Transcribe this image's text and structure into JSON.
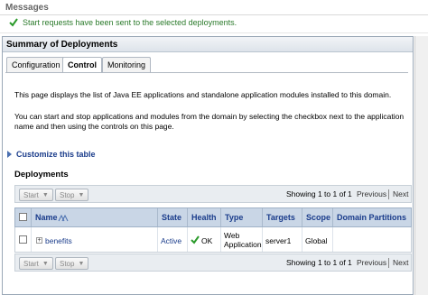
{
  "messages": {
    "title": "Messages",
    "text": "Start requests have been sent to the selected deployments."
  },
  "panel": {
    "title": "Summary of Deployments"
  },
  "tabs": [
    {
      "label": "Configuration"
    },
    {
      "label": "Control",
      "active": true
    },
    {
      "label": "Monitoring"
    }
  ],
  "description": {
    "p1": "This page displays the list of Java EE applications and standalone application modules installed to this domain.",
    "p2": "You can start and stop applications and modules from the domain by selecting the checkbox next to the application name and then using the controls on this page."
  },
  "customize_link": "Customize this table",
  "deployments": {
    "title": "Deployments",
    "start_label": "Start",
    "stop_label": "Stop",
    "showing": "Showing 1 to 1 of 1",
    "previous": "Previous",
    "next": "Next",
    "columns": [
      "Name",
      "State",
      "Health",
      "Type",
      "Targets",
      "Scope",
      "Domain Partitions"
    ],
    "rows": [
      {
        "name": "benefits",
        "state": "Active",
        "health": "OK",
        "type_line1": "Web",
        "type_line2": "Application",
        "targets": "server1",
        "scope": "Global",
        "partitions": ""
      }
    ]
  },
  "colors": {
    "success_green": "#2a7a2a",
    "link_blue": "#1a3c8b",
    "header_bg": "#c9d6e6"
  }
}
